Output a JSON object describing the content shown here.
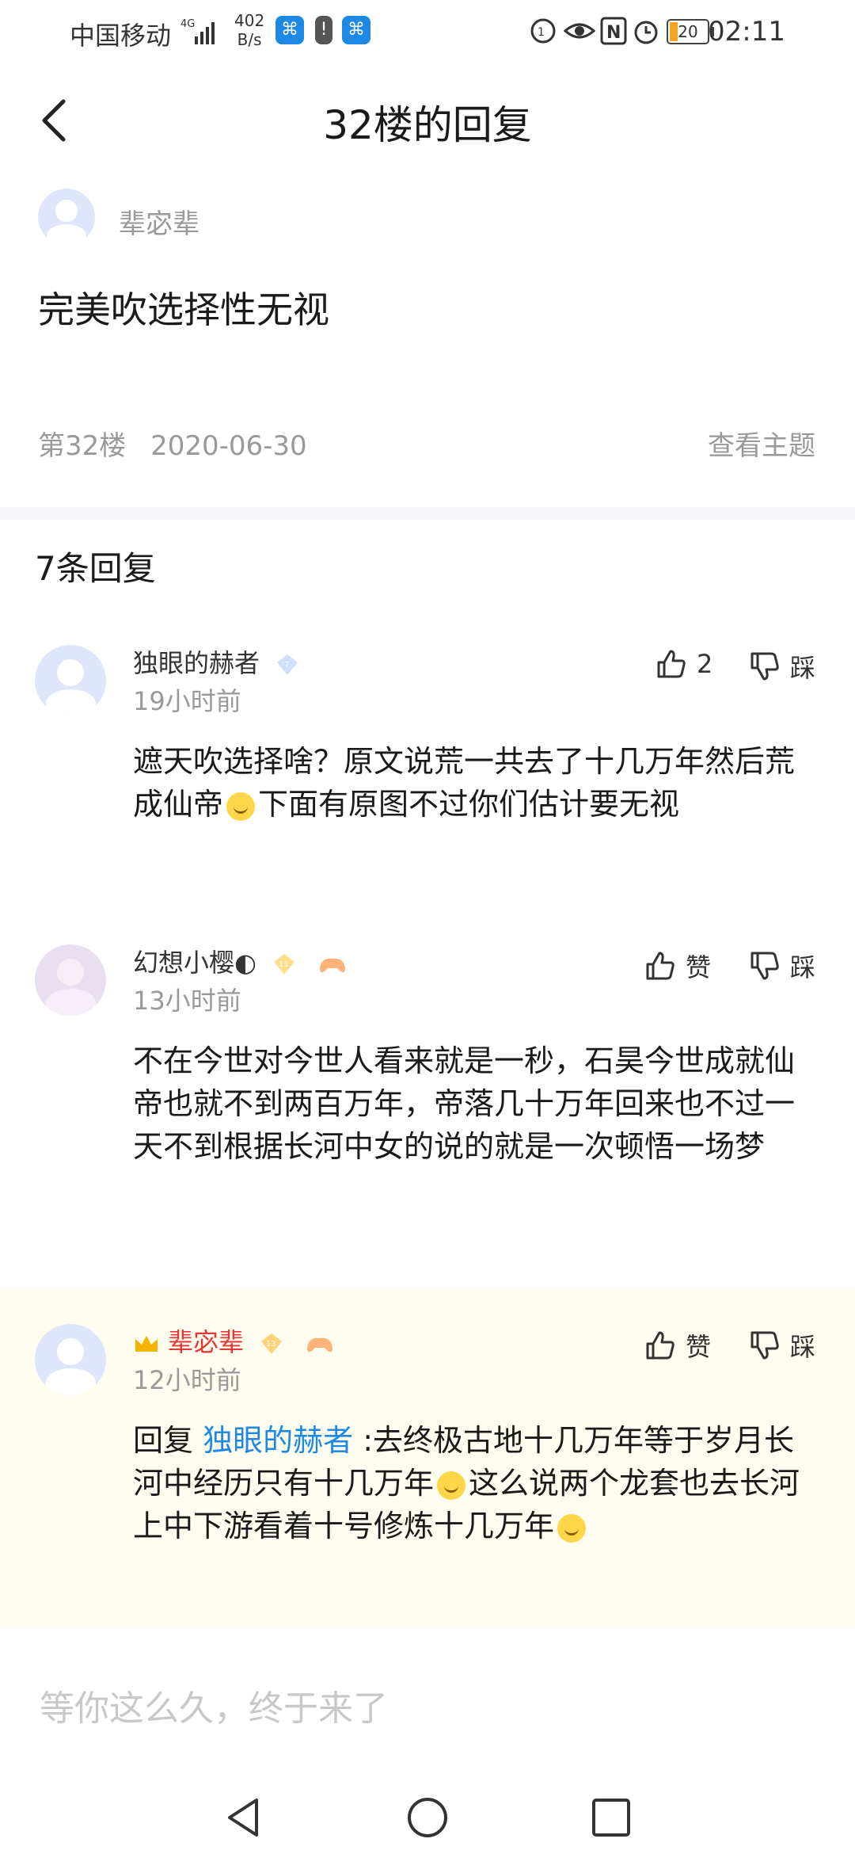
{
  "status_bar": {
    "carrier": "中国移动",
    "network": "4G",
    "speed_value": "402",
    "speed_unit": "B/s",
    "battery": "20",
    "time": "02:11"
  },
  "header": {
    "title": "32楼的回复"
  },
  "post": {
    "author": "辈宓辈",
    "content": "完美吹选择性无视",
    "floor": "第32楼",
    "date": "2020-06-30",
    "view_topic": "查看主题"
  },
  "reply_count": "7条回复",
  "replies": [
    {
      "nickname": "独眼的赫者",
      "level": "7",
      "time": "19小时前",
      "like_label": "2",
      "dislike_label": "踩",
      "content_part1": "遮天吹选择啥？原文说荒一共去了十几万年然后荒成仙帝",
      "content_part2": "下面有原图不过你们估计要无视"
    },
    {
      "nickname": "幻想小樱◐",
      "level": "11",
      "time": "13小时前",
      "like_label": "赞",
      "dislike_label": "踩",
      "content": "不在今世对今世人看来就是一秒，石昊今世成就仙帝也就不到两百万年，帝落几十万年回来也不过一天不到根据长河中女的说的就是一次顿悟一场梦"
    },
    {
      "nickname": "辈宓辈",
      "level": "13",
      "time": "12小时前",
      "like_label": "赞",
      "dislike_label": "踩",
      "reply_prefix": "回复 ",
      "reply_to": "独眼的赫者",
      "content_part1": " :去终极古地十几万年等于岁月长河中经历只有十几万年",
      "content_part2": "这么说两个龙套也去长河上中下游看着十号修炼十几万年"
    }
  ],
  "input": {
    "placeholder": "等你这么久，终于来了"
  },
  "colors": {
    "link": "#1e88e5",
    "op_name": "#e53935",
    "highlight_bg": "#fffdf0"
  }
}
